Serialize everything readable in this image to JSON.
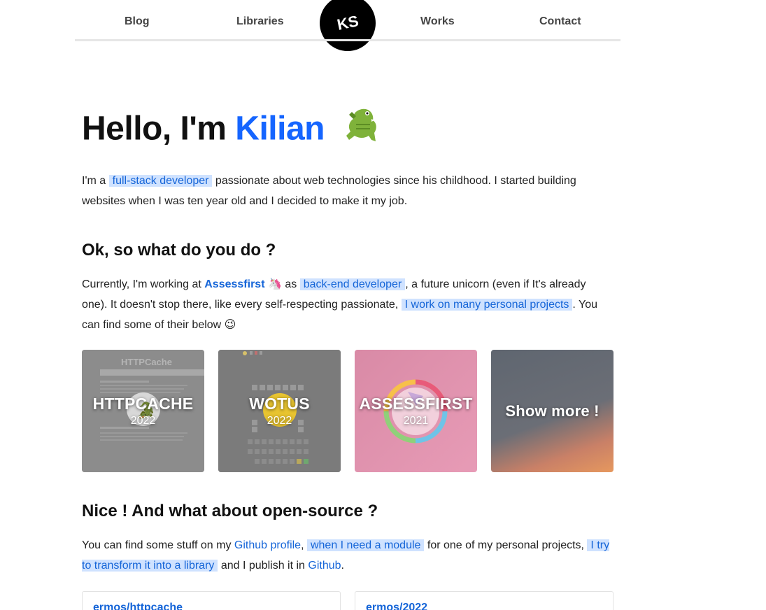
{
  "nav": {
    "items": [
      "Blog",
      "Libraries",
      "Works",
      "Contact"
    ],
    "logo_text": "KS"
  },
  "hero": {
    "greeting": "Hello, I'm ",
    "name": "Kilian",
    "emoji_icon": "crocodile-icon"
  },
  "intro": {
    "part1": "I'm a ",
    "highlight": "full-stack developer",
    "part2": " passionate about web technologies since his childhood. I started building websites when I was ten year old and I decided to make it my job."
  },
  "section1": {
    "title": "Ok, so what do you do ?",
    "p_part1": "Currently, I'm working at ",
    "company": "Assessfirst",
    "company_icon": "unicorn-icon",
    "p_part2": " as ",
    "role": "back-end developer",
    "p_part3": ", a future unicorn (even if It's already one). It doesn't stop there, like every self-respecting passionate, ",
    "projects": "I work on many personal projects",
    "p_part4": ". You can find some of their below ",
    "wink_icon": "winking-face-icon"
  },
  "cards": [
    {
      "title": "HTTPCACHE",
      "year": "2022"
    },
    {
      "title": "WOTUS",
      "year": "2022"
    },
    {
      "title": "ASSESSFIRST",
      "year": "2021"
    },
    {
      "title": "Show more !",
      "year": ""
    }
  ],
  "section2": {
    "title": "Nice ! And what about open-source ?",
    "p_part1": "You can find some stuff on my ",
    "github_profile": "Github profile",
    "p_part2": ", ",
    "module": "when I need a module",
    "p_part3": " for one of my personal projects, ",
    "library": "I try to transform it into a library",
    "p_part4": " and I publish it in ",
    "github": "Github",
    "p_part5": "."
  },
  "repos": [
    "ermos/httpcache",
    "ermos/2022"
  ],
  "colors": {
    "accent": "#1565ff",
    "highlight_bg": "#cfe2ff"
  }
}
